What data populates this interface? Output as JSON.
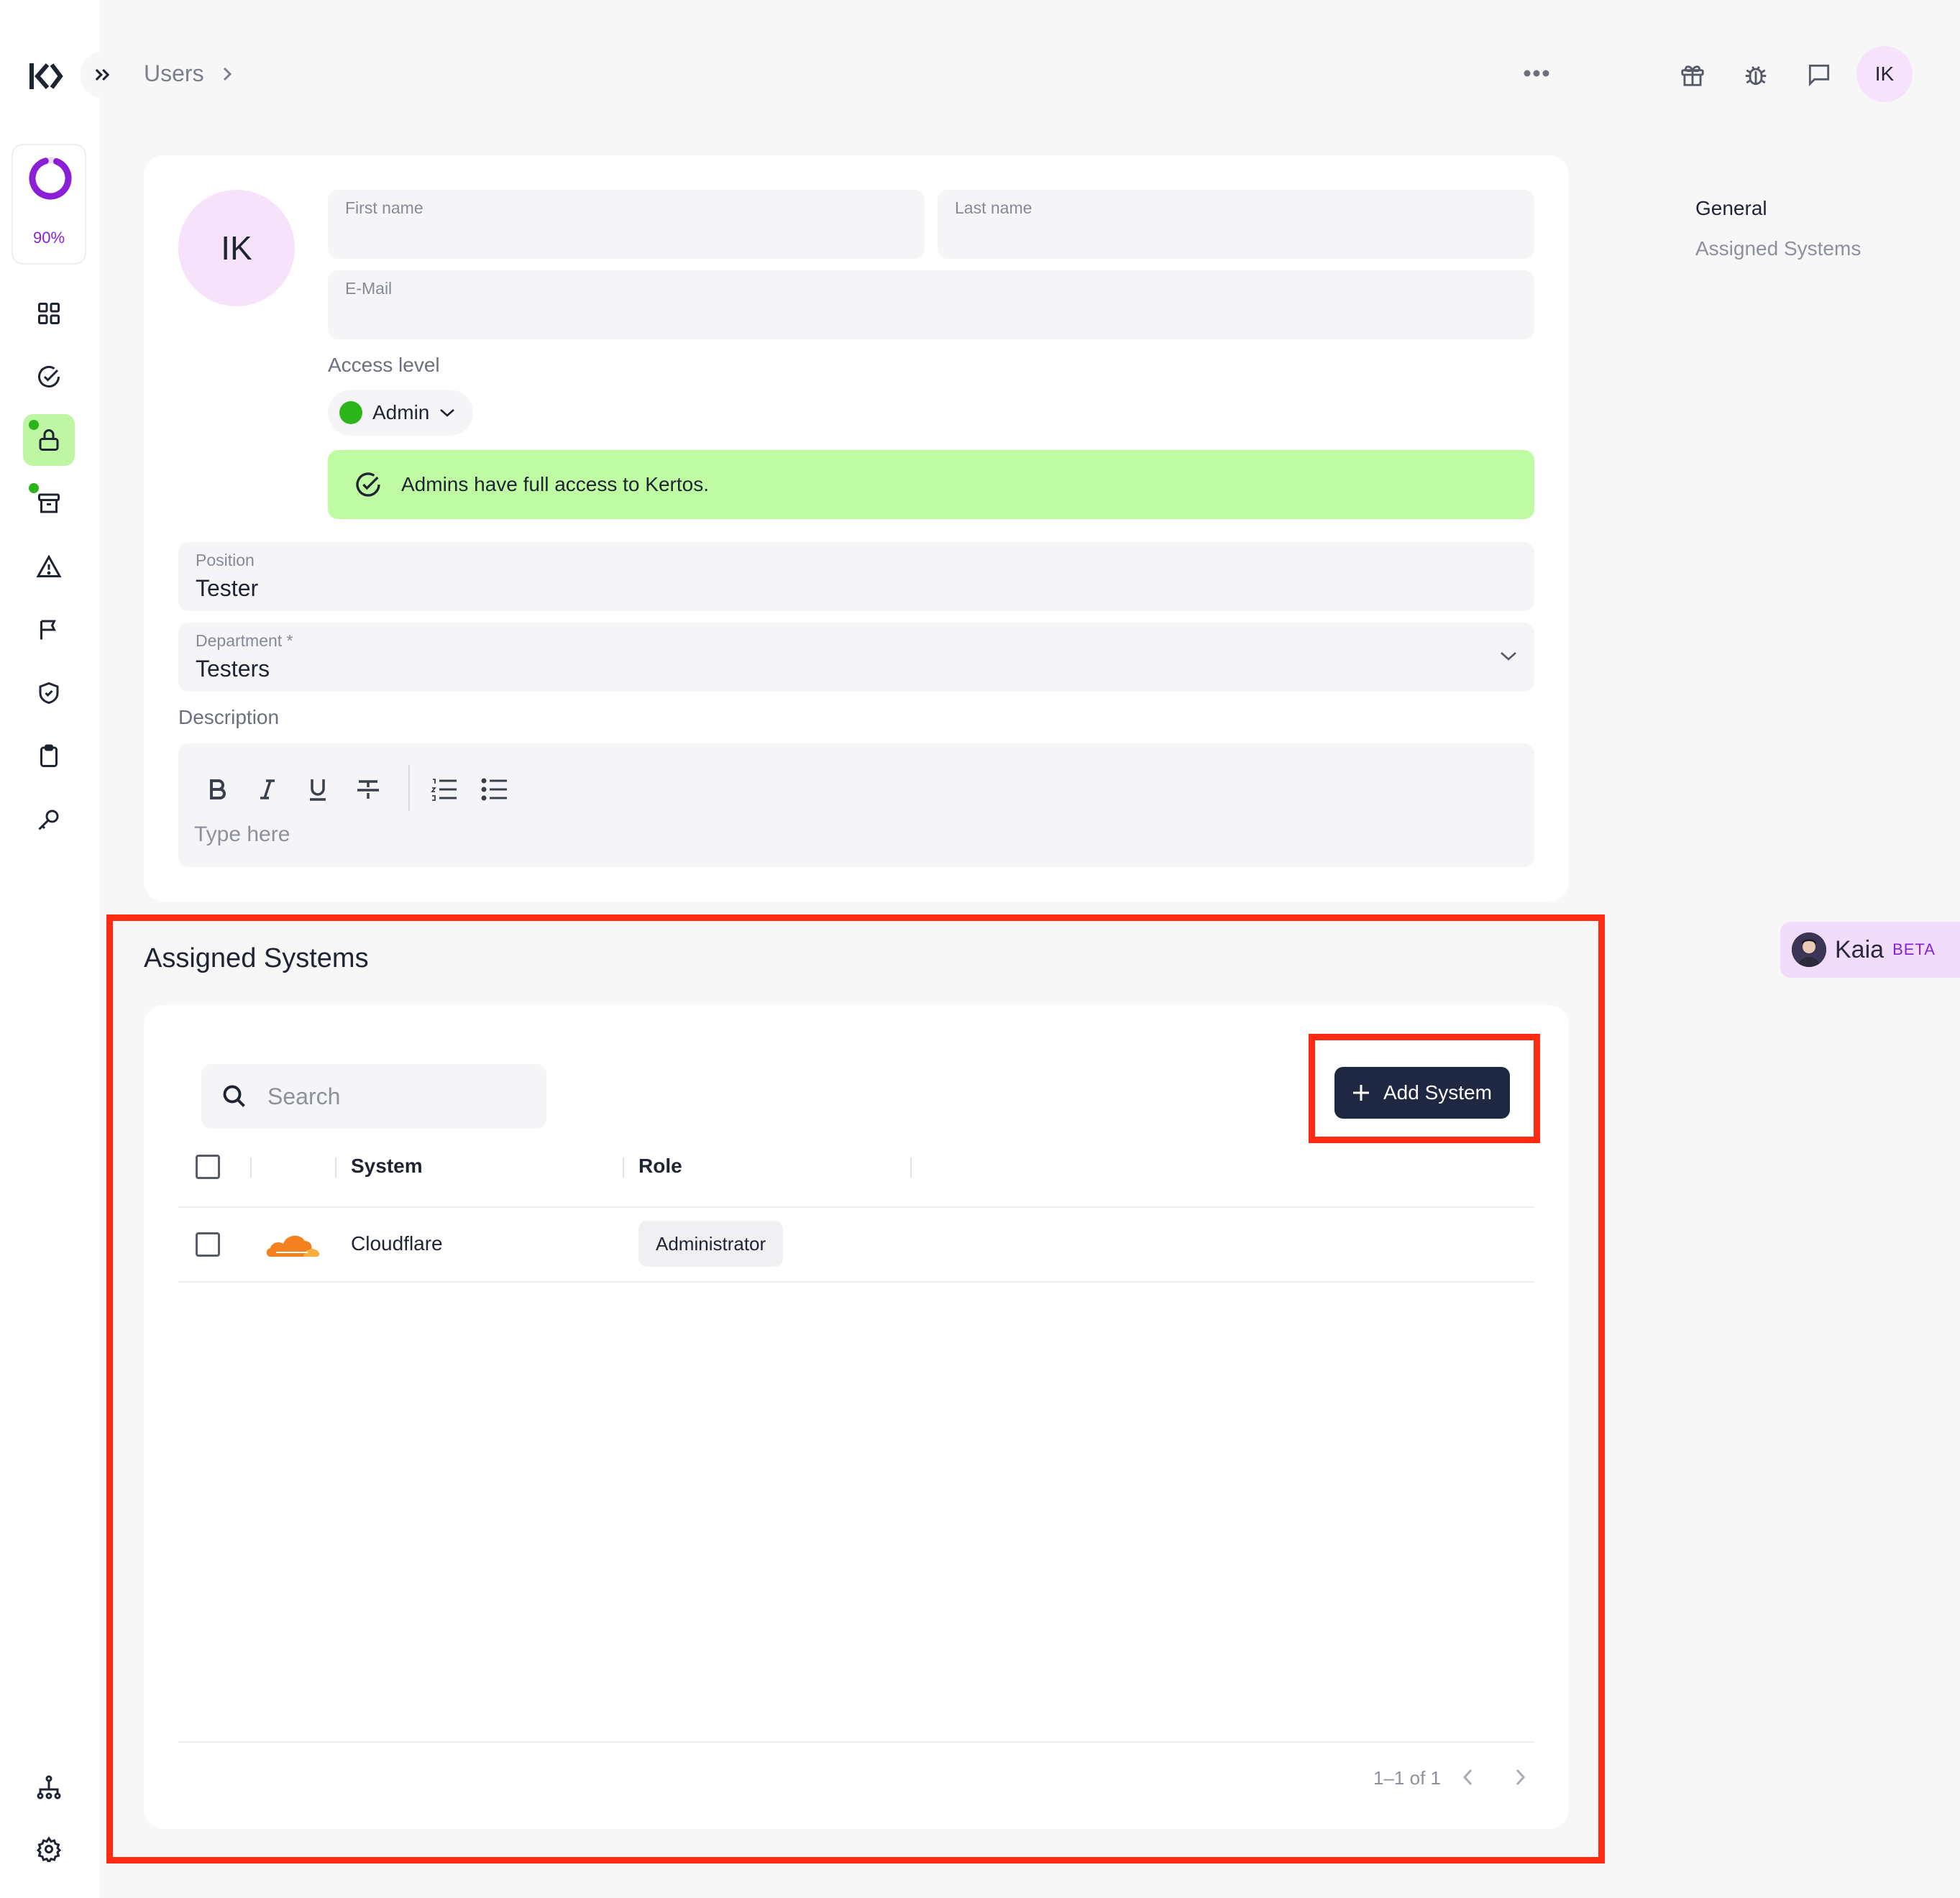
{
  "header": {
    "breadcrumb": "Users",
    "avatar_initials": "IK"
  },
  "sidebar": {
    "progress_percent": "90%",
    "progress_value": 0.9,
    "brand_color": "#8a1fd6",
    "active_color": "#bff6a3"
  },
  "general": {
    "avatar_initials": "IK",
    "first_name": {
      "label": "First name",
      "value": ""
    },
    "last_name": {
      "label": "Last name",
      "value": ""
    },
    "email": {
      "label": "E-Mail",
      "value": ""
    },
    "access_level_label": "Access level",
    "access_level_value": "Admin",
    "access_banner": "Admins have full access to Kertos.",
    "position": {
      "label": "Position",
      "value": "Tester"
    },
    "department": {
      "label": "Department *",
      "value": "Testers"
    },
    "description_label": "Description",
    "description_placeholder": "Type here"
  },
  "right_nav": {
    "items": [
      "General",
      "Assigned Systems"
    ]
  },
  "kaia": {
    "name": "Kaia",
    "badge": "BETA"
  },
  "assigned_systems": {
    "title": "Assigned Systems",
    "search_placeholder": "Search",
    "add_button": "Add System",
    "columns": [
      "System",
      "Role"
    ],
    "rows": [
      {
        "system": "Cloudflare",
        "role": "Administrator"
      }
    ],
    "pagination": "1–1 of 1"
  }
}
